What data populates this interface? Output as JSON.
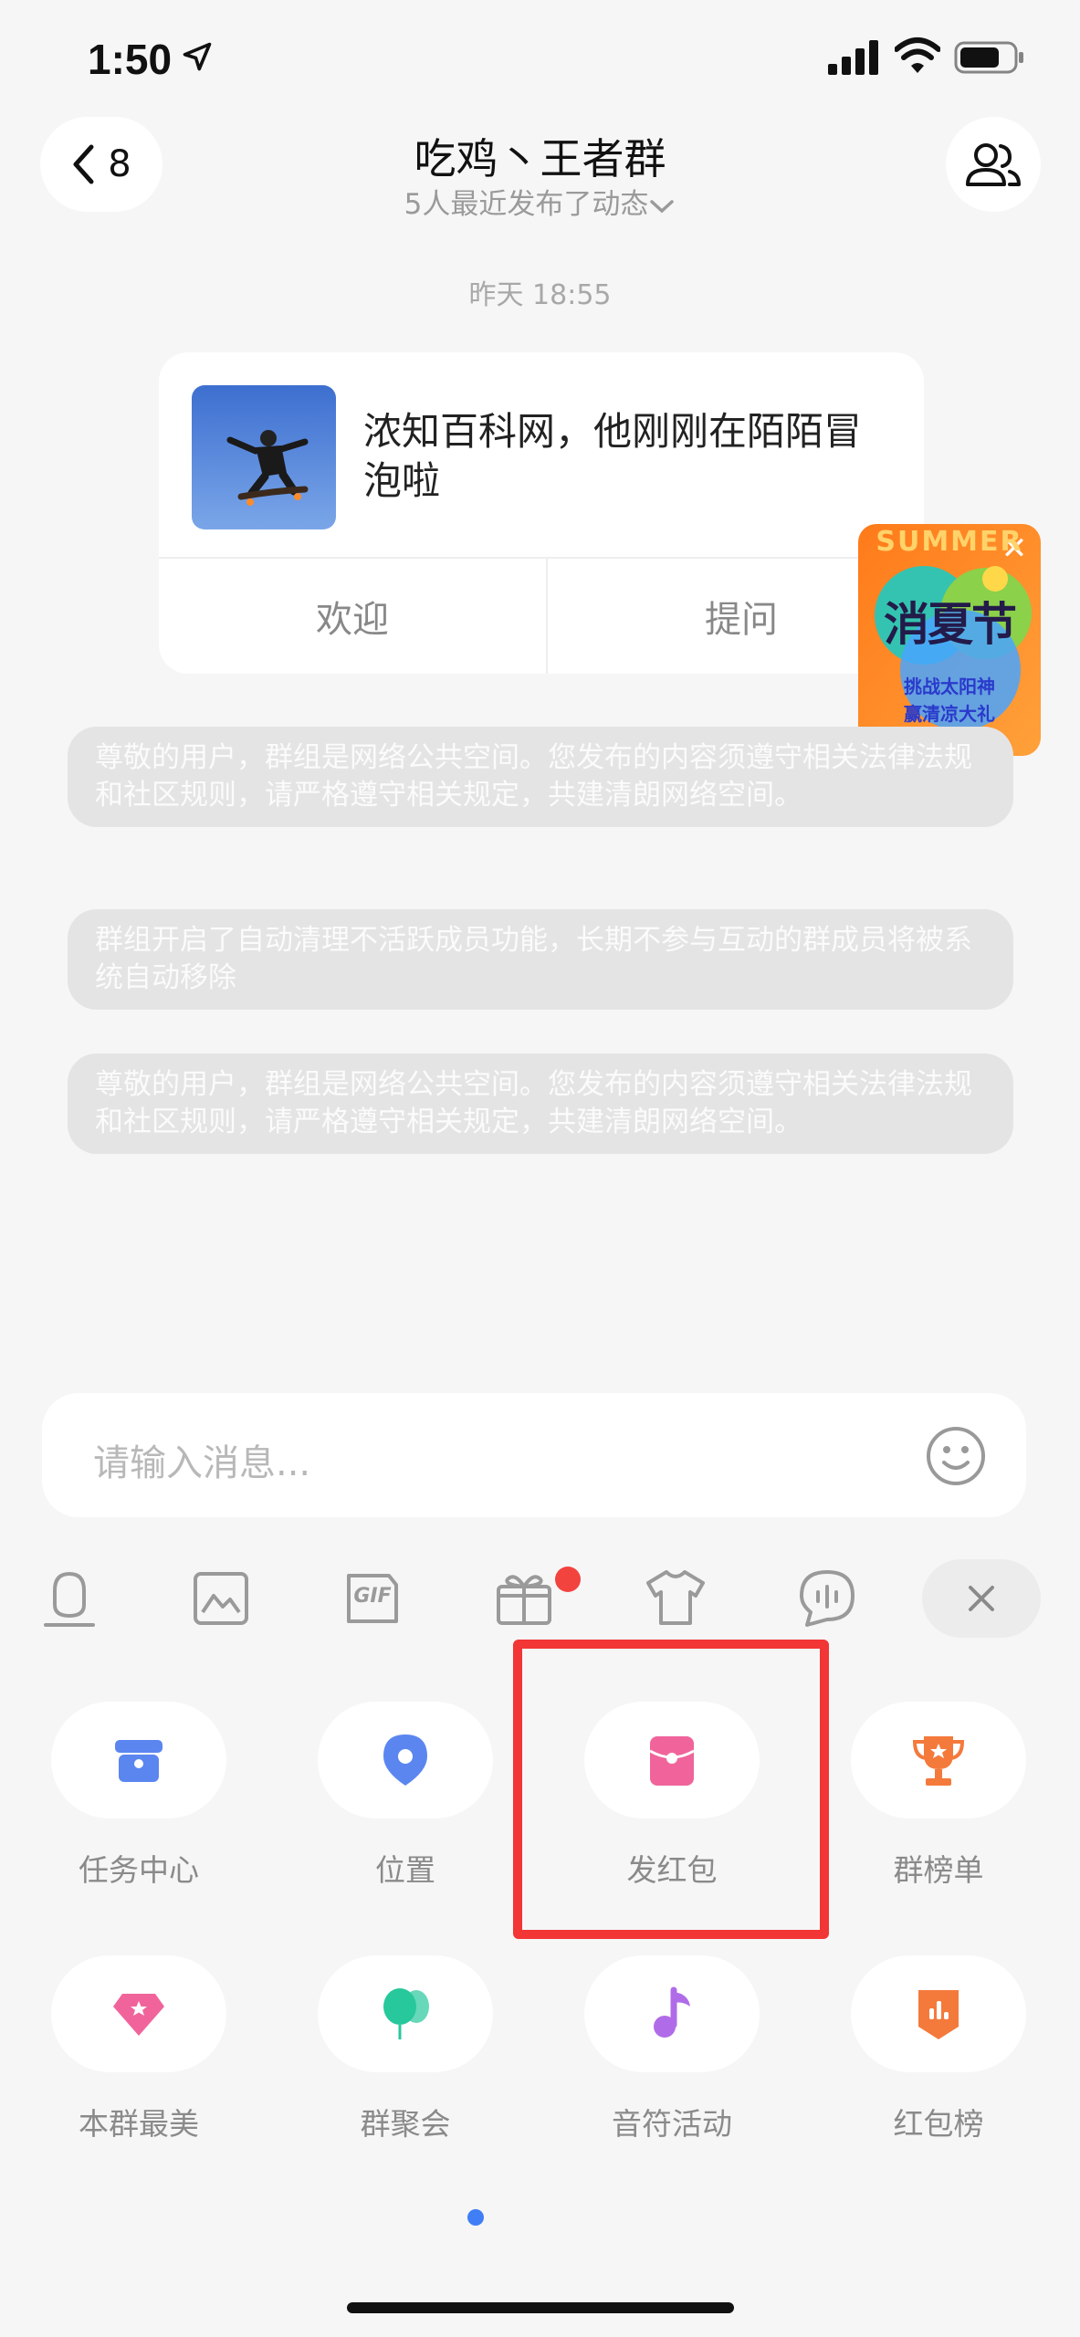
{
  "status_bar": {
    "time": "1:50"
  },
  "header": {
    "back_count": "8",
    "title": "吃鸡丶王者群",
    "subtitle": "5人最近发布了动态"
  },
  "timestamp": "昨天 18:55",
  "card": {
    "text": "浓知百科网，他刚刚在陌陌冒泡啦",
    "welcome_label": "欢迎",
    "ask_label": "提问"
  },
  "promo": {
    "banner_text": "SUMMER",
    "title": "消夏节",
    "line1": "挑战太阳神",
    "line2": "赢清凉大礼"
  },
  "notices": [
    "尊敬的用户，群组是网络公共空间。您发布的内容须遵守相关法律法规和社区规则，请严格遵守相关规定，共建清朗网络空间。",
    "群组开启了自动清理不活跃成员功能，长期不参与互动的群成员将被系统自动移除",
    "尊敬的用户，群组是网络公共空间。您发布的内容须遵守相关法律法规和社区规则，请严格遵守相关规定，共建清朗网络空间。"
  ],
  "input": {
    "placeholder": "请输入消息..."
  },
  "toolbar": {
    "gif_label": "GIF"
  },
  "grid": [
    {
      "label": "任务中心",
      "icon": "task-box-icon",
      "color": "#5b86f0"
    },
    {
      "label": "位置",
      "icon": "location-pin-icon",
      "color": "#5b86f0"
    },
    {
      "label": "发红包",
      "icon": "red-envelope-icon",
      "color": "#f0649b"
    },
    {
      "label": "群榜单",
      "icon": "trophy-icon",
      "color": "#f47a3c"
    },
    {
      "label": "本群最美",
      "icon": "diamond-icon",
      "color": "#f0649b"
    },
    {
      "label": "群聚会",
      "icon": "balloon-icon",
      "color": "#27c89b"
    },
    {
      "label": "音符活动",
      "icon": "music-note-icon",
      "color": "#b06ce8"
    },
    {
      "label": "红包榜",
      "icon": "ranking-bar-icon",
      "color": "#f47a3c"
    }
  ],
  "colors": {
    "highlight": "#f23535",
    "page_dot": "#3f7ef5",
    "badge": "#f2433f"
  }
}
